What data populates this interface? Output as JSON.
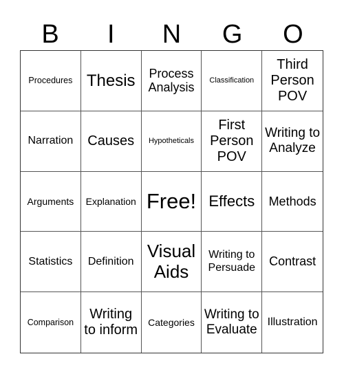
{
  "title_letters": [
    "B",
    "I",
    "N",
    "G",
    "O"
  ],
  "cells": [
    "Procedures",
    "Thesis",
    "Process Analysis",
    "Classification",
    "Third Person POV",
    "Narration",
    "Causes",
    "Hypotheticals",
    "First Person POV",
    "Writing to Analyze",
    "Arguments",
    "Explanation",
    "Free!",
    "Effects",
    "Methods",
    "Statistics",
    "Definition",
    "Visual Aids",
    "Writing to Persuade",
    "Contrast",
    "Comparison",
    "Writing to inform",
    "Categories",
    "Writing to Evaluate",
    "Illustration"
  ]
}
